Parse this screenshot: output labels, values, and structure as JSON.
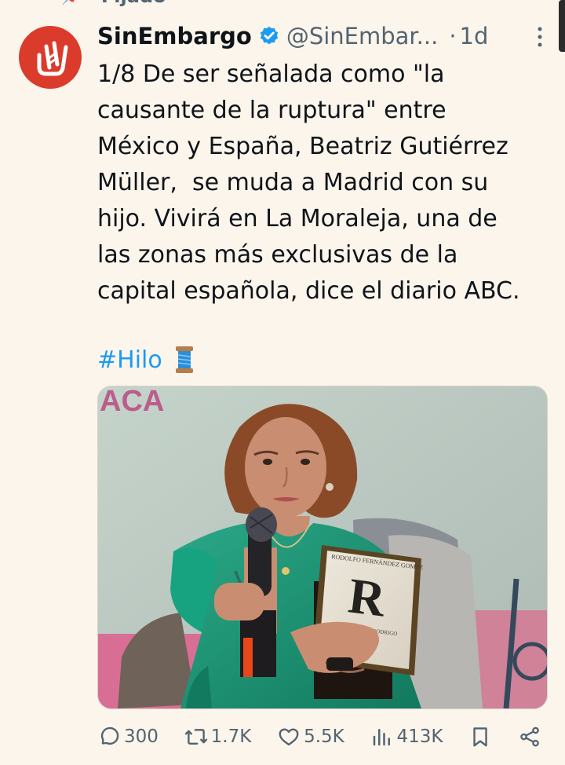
{
  "pinned": {
    "label": "Fijado"
  },
  "account": {
    "display_name": "SinEmbargo",
    "handle": "@SinEmbar...",
    "time": "1d",
    "avatar_icon": "sinembargo-logo-icon",
    "verified_icon": "verified-badge-icon"
  },
  "post": {
    "text_lines": [
      "1/8 De ser señalada como \"la",
      "causante de la ruptura\" entre",
      "México y España, Beatriz Gutiérrez",
      "Müller,  se muda a Madrid con su",
      "hijo. Vivirá en La Moraleja, una de",
      "las zonas más exclusivas de la",
      "capital española, dice el diario ABC."
    ],
    "hashtag": "#Hilo",
    "hashtag_icon": "thread-spool-icon"
  },
  "media": {
    "sign_text": "ACA",
    "book_letter": "R",
    "book_author": "RODOLFO FERNÁNDEZ GOMEZ",
    "book_caption": "DANIEL RODRIGO",
    "content": "woman-holding-book-photo"
  },
  "actions": {
    "replies": "300",
    "reposts": "1.7K",
    "likes": "5.5K",
    "views": "413K",
    "icons": [
      "reply-icon",
      "repost-icon",
      "like-icon",
      "views-icon",
      "bookmark-icon",
      "share-icon"
    ]
  },
  "colors": {
    "background": "#fcf5ec",
    "text": "#0f1419",
    "secondary": "#536471",
    "link": "#1d9bf0",
    "avatar": "#db3b2b"
  }
}
